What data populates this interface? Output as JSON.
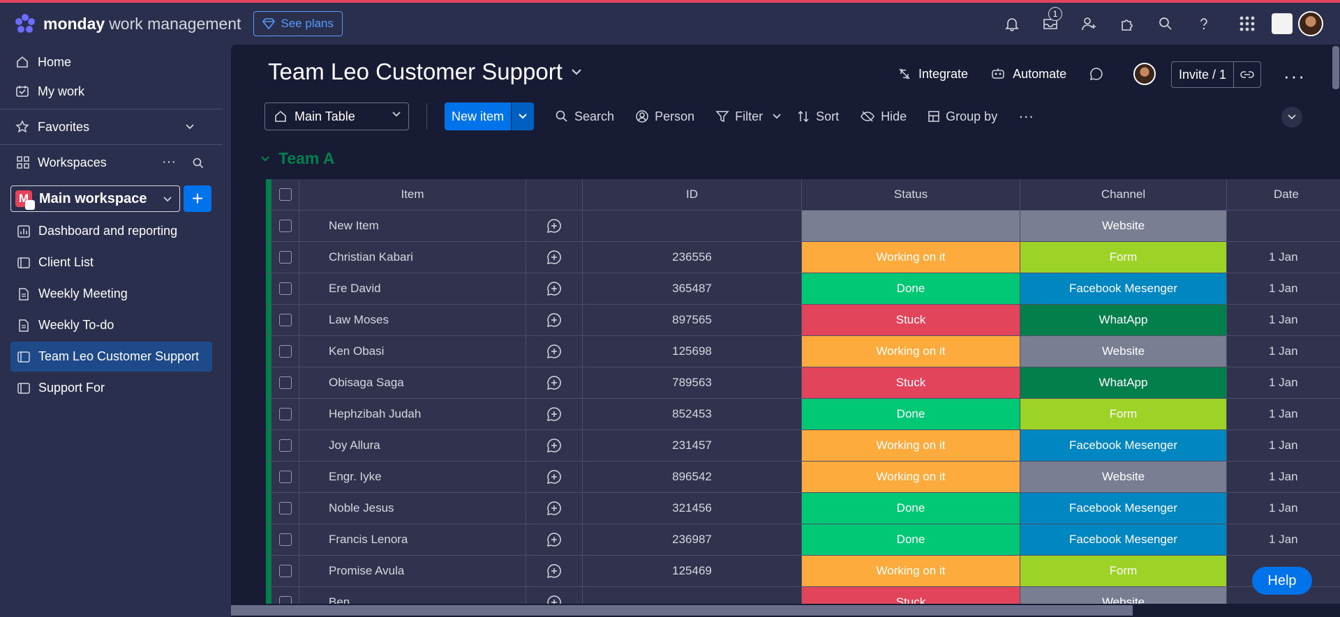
{
  "topbar": {
    "brand_bold": "monday",
    "brand_rest": "work management",
    "see_plans": "See plans",
    "inbox_badge": "1",
    "icons": [
      "bell-icon",
      "inbox-icon",
      "invite-members-icon",
      "apps-icon",
      "search-icon",
      "help-icon",
      "app-grid-icon"
    ]
  },
  "sidebar": {
    "home": "Home",
    "my_work": "My work",
    "favorites": "Favorites",
    "workspaces": "Workspaces",
    "workspace_initial": "M",
    "workspace_name": "Main workspace",
    "add_symbol": "+",
    "boards": [
      {
        "label": "Dashboard and reporting",
        "icon": "dashboard-icon"
      },
      {
        "label": "Client List",
        "icon": "board-icon"
      },
      {
        "label": "Weekly Meeting",
        "icon": "doc-icon"
      },
      {
        "label": "Weekly To-do",
        "icon": "doc-icon"
      },
      {
        "label": "Team Leo Customer Support",
        "icon": "board-icon",
        "active": true
      },
      {
        "label": "Support For",
        "icon": "board-icon"
      }
    ]
  },
  "board": {
    "title": "Team Leo Customer Support",
    "integrate": "Integrate",
    "automate": "Automate",
    "invite": "Invite / 1",
    "more": "···",
    "view": "Main Table",
    "new_item": "New item",
    "toolbar": {
      "search": "Search",
      "person": "Person",
      "filter": "Filter",
      "sort": "Sort",
      "hide": "Hide",
      "group_by": "Group by",
      "more": "···"
    },
    "group": "Team A",
    "columns": {
      "item": "Item",
      "id": "ID",
      "status": "Status",
      "channel": "Channel",
      "date": "Date"
    },
    "rows": [
      {
        "item": "New Item",
        "id": "",
        "status": "",
        "channel": "Website",
        "date": ""
      },
      {
        "item": "Christian Kabari",
        "id": "236556",
        "status": "Working on it",
        "channel": "Form",
        "date": "1 Jan"
      },
      {
        "item": "Ere David",
        "id": "365487",
        "status": "Done",
        "channel": "Facebook Mesenger",
        "date": "1 Jan"
      },
      {
        "item": "Law Moses",
        "id": "897565",
        "status": "Stuck",
        "channel": "WhatApp",
        "date": "1 Jan"
      },
      {
        "item": "Ken Obasi",
        "id": "125698",
        "status": "Working on it",
        "channel": "Website",
        "date": "1 Jan"
      },
      {
        "item": "Obisaga Saga",
        "id": "789563",
        "status": "Stuck",
        "channel": "WhatApp",
        "date": "1 Jan"
      },
      {
        "item": "Hephzibah Judah",
        "id": "852453",
        "status": "Done",
        "channel": "Form",
        "date": "1 Jan"
      },
      {
        "item": "Joy Allura",
        "id": "231457",
        "status": "Working on it",
        "channel": "Facebook Mesenger",
        "date": "1 Jan"
      },
      {
        "item": "Engr. Iyke",
        "id": "896542",
        "status": "Working on it",
        "channel": "Website",
        "date": "1 Jan"
      },
      {
        "item": "Noble Jesus",
        "id": "321456",
        "status": "Done",
        "channel": "Facebook Mesenger",
        "date": "1 Jan"
      },
      {
        "item": "Francis Lenora",
        "id": "236987",
        "status": "Done",
        "channel": "Facebook Mesenger",
        "date": "1 Jan"
      },
      {
        "item": "Promise Avula",
        "id": "125469",
        "status": "Working on it",
        "channel": "Form",
        "date": ""
      },
      {
        "item": "Ben",
        "id": "",
        "status": "Stuck",
        "channel": "Website",
        "date": ""
      }
    ]
  },
  "colors": {
    "status": {
      "Working on it": "#fdab3d",
      "Done": "#00c875",
      "Stuck": "#e2445c",
      "": "#797e93"
    },
    "channel": {
      "Website": "#797e93",
      "Form": "#9cd326",
      "Facebook Mesenger": "#0086c0",
      "WhatApp": "#037f4c"
    }
  },
  "help": "Help"
}
